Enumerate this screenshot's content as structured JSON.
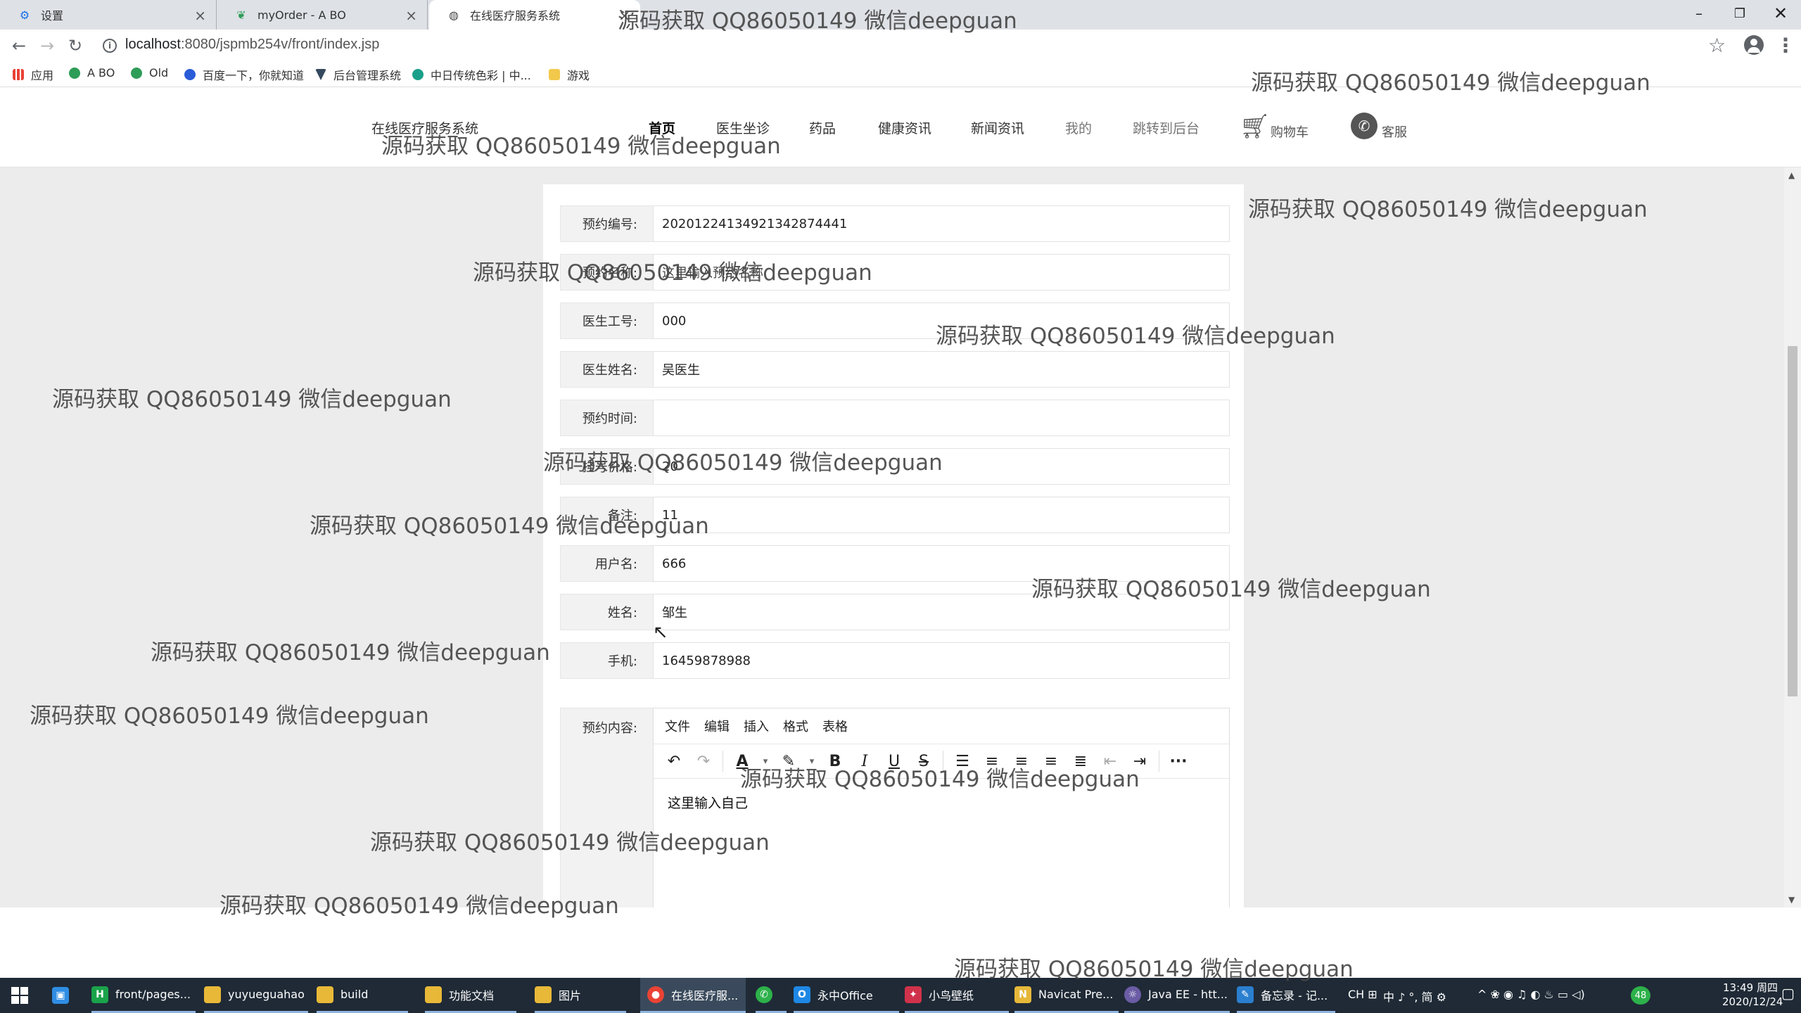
{
  "browser": {
    "tabs": [
      {
        "title": "设置",
        "icon": "gear-icon"
      },
      {
        "title": "myOrder - A BO",
        "icon": "leaf-icon"
      },
      {
        "title": "在线医疗服务系统",
        "icon": "globe-icon"
      }
    ],
    "url_host": "localhost",
    "url_path": ":8080/jspmb254v/front/index.jsp",
    "bookmarks": [
      {
        "label": "应用",
        "icon": "apps-grid-icon"
      },
      {
        "label": "A BO",
        "icon": "leaf-icon"
      },
      {
        "label": "Old",
        "icon": "leaf-icon"
      },
      {
        "label": "百度一下，你就知道",
        "icon": "baidu-paw-icon"
      },
      {
        "label": "后台管理系统",
        "icon": "vue-v-icon"
      },
      {
        "label": "中日传统色彩 | 中...",
        "icon": "gear-bookmark-icon"
      },
      {
        "label": "游戏",
        "icon": "folder-icon"
      }
    ]
  },
  "site": {
    "title": "在线医疗服务系统",
    "nav": [
      "首页",
      "医生坐诊",
      "药品",
      "健康资讯",
      "新闻资讯",
      "我的",
      "跳转到后台"
    ],
    "cart_label": "购物车",
    "service_label": "客服"
  },
  "form": {
    "fields": [
      {
        "label": "预约编号:",
        "value": "20201224134921342874441"
      },
      {
        "label": "预约名称:",
        "value": "这里输入预约名称"
      },
      {
        "label": "医生工号:",
        "value": "000"
      },
      {
        "label": "医生姓名:",
        "value": "吴医生"
      },
      {
        "label": "预约时间:",
        "value": ""
      },
      {
        "label": "挂号价格:",
        "value": "20"
      },
      {
        "label": "备注:",
        "value": "11"
      },
      {
        "label": "用户名:",
        "value": "666"
      },
      {
        "label": "姓名:",
        "value": "邹生"
      },
      {
        "label": "手机:",
        "value": "16459878988"
      }
    ],
    "editor_label": "预约内容:",
    "editor_menus": [
      "文件",
      "编辑",
      "插入",
      "格式",
      "表格"
    ],
    "editor_text": "这里输入自己"
  },
  "watermark_text": "源码获取 QQ86050149 微信deepguan",
  "taskbar": {
    "items": [
      {
        "label": "front/pages...",
        "icon_color": "#1aa34a",
        "icon": "H"
      },
      {
        "label": "yuyueguahao",
        "icon_color": "#e8b838",
        "icon": "folder"
      },
      {
        "label": "build",
        "icon_color": "#e8b838",
        "icon": "folder"
      },
      {
        "label": "功能文档",
        "icon_color": "#e8b838",
        "icon": "folder"
      },
      {
        "label": "图片",
        "icon_color": "#e8b838",
        "icon": "folder"
      },
      {
        "label": "在线医疗服...",
        "icon_color": "#ea4335",
        "icon": "chrome"
      },
      {
        "label": "",
        "icon_color": "#2db14a",
        "icon": "wechat"
      },
      {
        "label": "永中Office",
        "icon_color": "#1e88e5",
        "icon": "O"
      },
      {
        "label": "小鸟壁纸",
        "icon_color": "#d0324b",
        "icon": "bird"
      },
      {
        "label": "Navicat Pre...",
        "icon_color": "#e6b83a",
        "icon": "navicat"
      },
      {
        "label": "Java EE - htt...",
        "icon_color": "#6b5ca5",
        "icon": "eclipse"
      },
      {
        "label": "备忘录 - 记...",
        "icon_color": "#2b7fcf",
        "icon": "notepad"
      }
    ],
    "tray_text": "中 ♪ °, 简 ⚙",
    "time": "13:49 周四",
    "date": "2020/12/24",
    "badge": "48"
  }
}
